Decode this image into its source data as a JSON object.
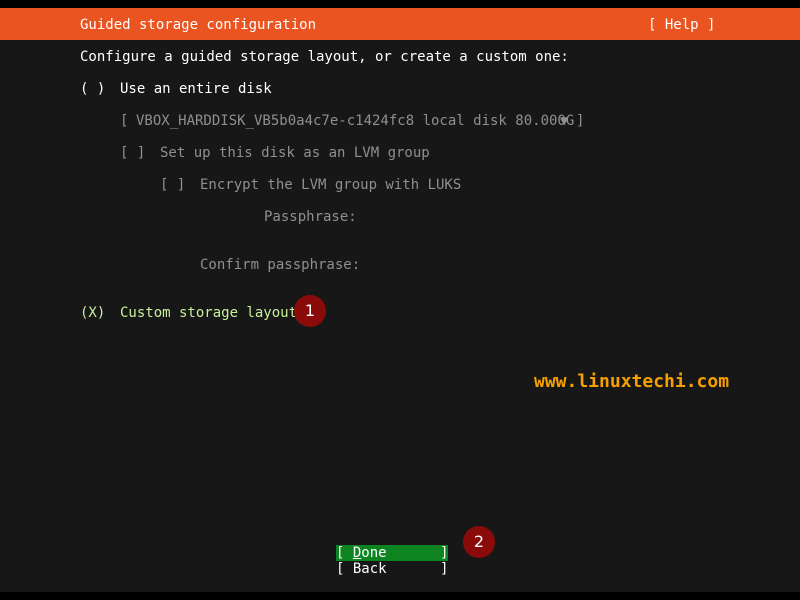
{
  "header": {
    "title": "Guided storage configuration",
    "help_label": "[ Help ]"
  },
  "main": {
    "intro": "Configure a guided storage layout, or create a custom one:",
    "entire_disk": {
      "radio": "( )",
      "label": "Use an entire disk"
    },
    "disk_select": {
      "open_bracket": "[",
      "value": "VBOX_HARDDISK_VB5b0a4c7e-c1424fc8 local disk 80.000G",
      "arrow": "▼",
      "close_bracket": "]"
    },
    "lvm_group": {
      "checkbox": "[ ]",
      "label": "Set up this disk as an LVM group"
    },
    "encrypt_luks": {
      "checkbox": "[ ]",
      "label": "Encrypt the LVM group with LUKS"
    },
    "passphrase": {
      "label": "Passphrase:"
    },
    "confirm_passphrase": {
      "label": "Confirm passphrase:"
    },
    "custom_layout": {
      "radio": "(X)",
      "label": "Custom storage layout"
    }
  },
  "annotations": {
    "marker_1": "1",
    "marker_2": "2",
    "watermark": "www.linuxtechi.com"
  },
  "buttons": {
    "done": {
      "open": "[ ",
      "hotkey": "D",
      "rest": "one",
      "close": "]"
    },
    "back": {
      "open": "[ ",
      "label": "Back",
      "close": "]"
    }
  },
  "colors": {
    "header_bg": "#e95420",
    "terminal_bg": "#171717",
    "selected_button_bg": "#0e8420",
    "accent_text": "#c7f09a",
    "dim_text": "#8f8f8f",
    "marker_bg": "#8b0b0b",
    "watermark_text": "#f5a000"
  }
}
